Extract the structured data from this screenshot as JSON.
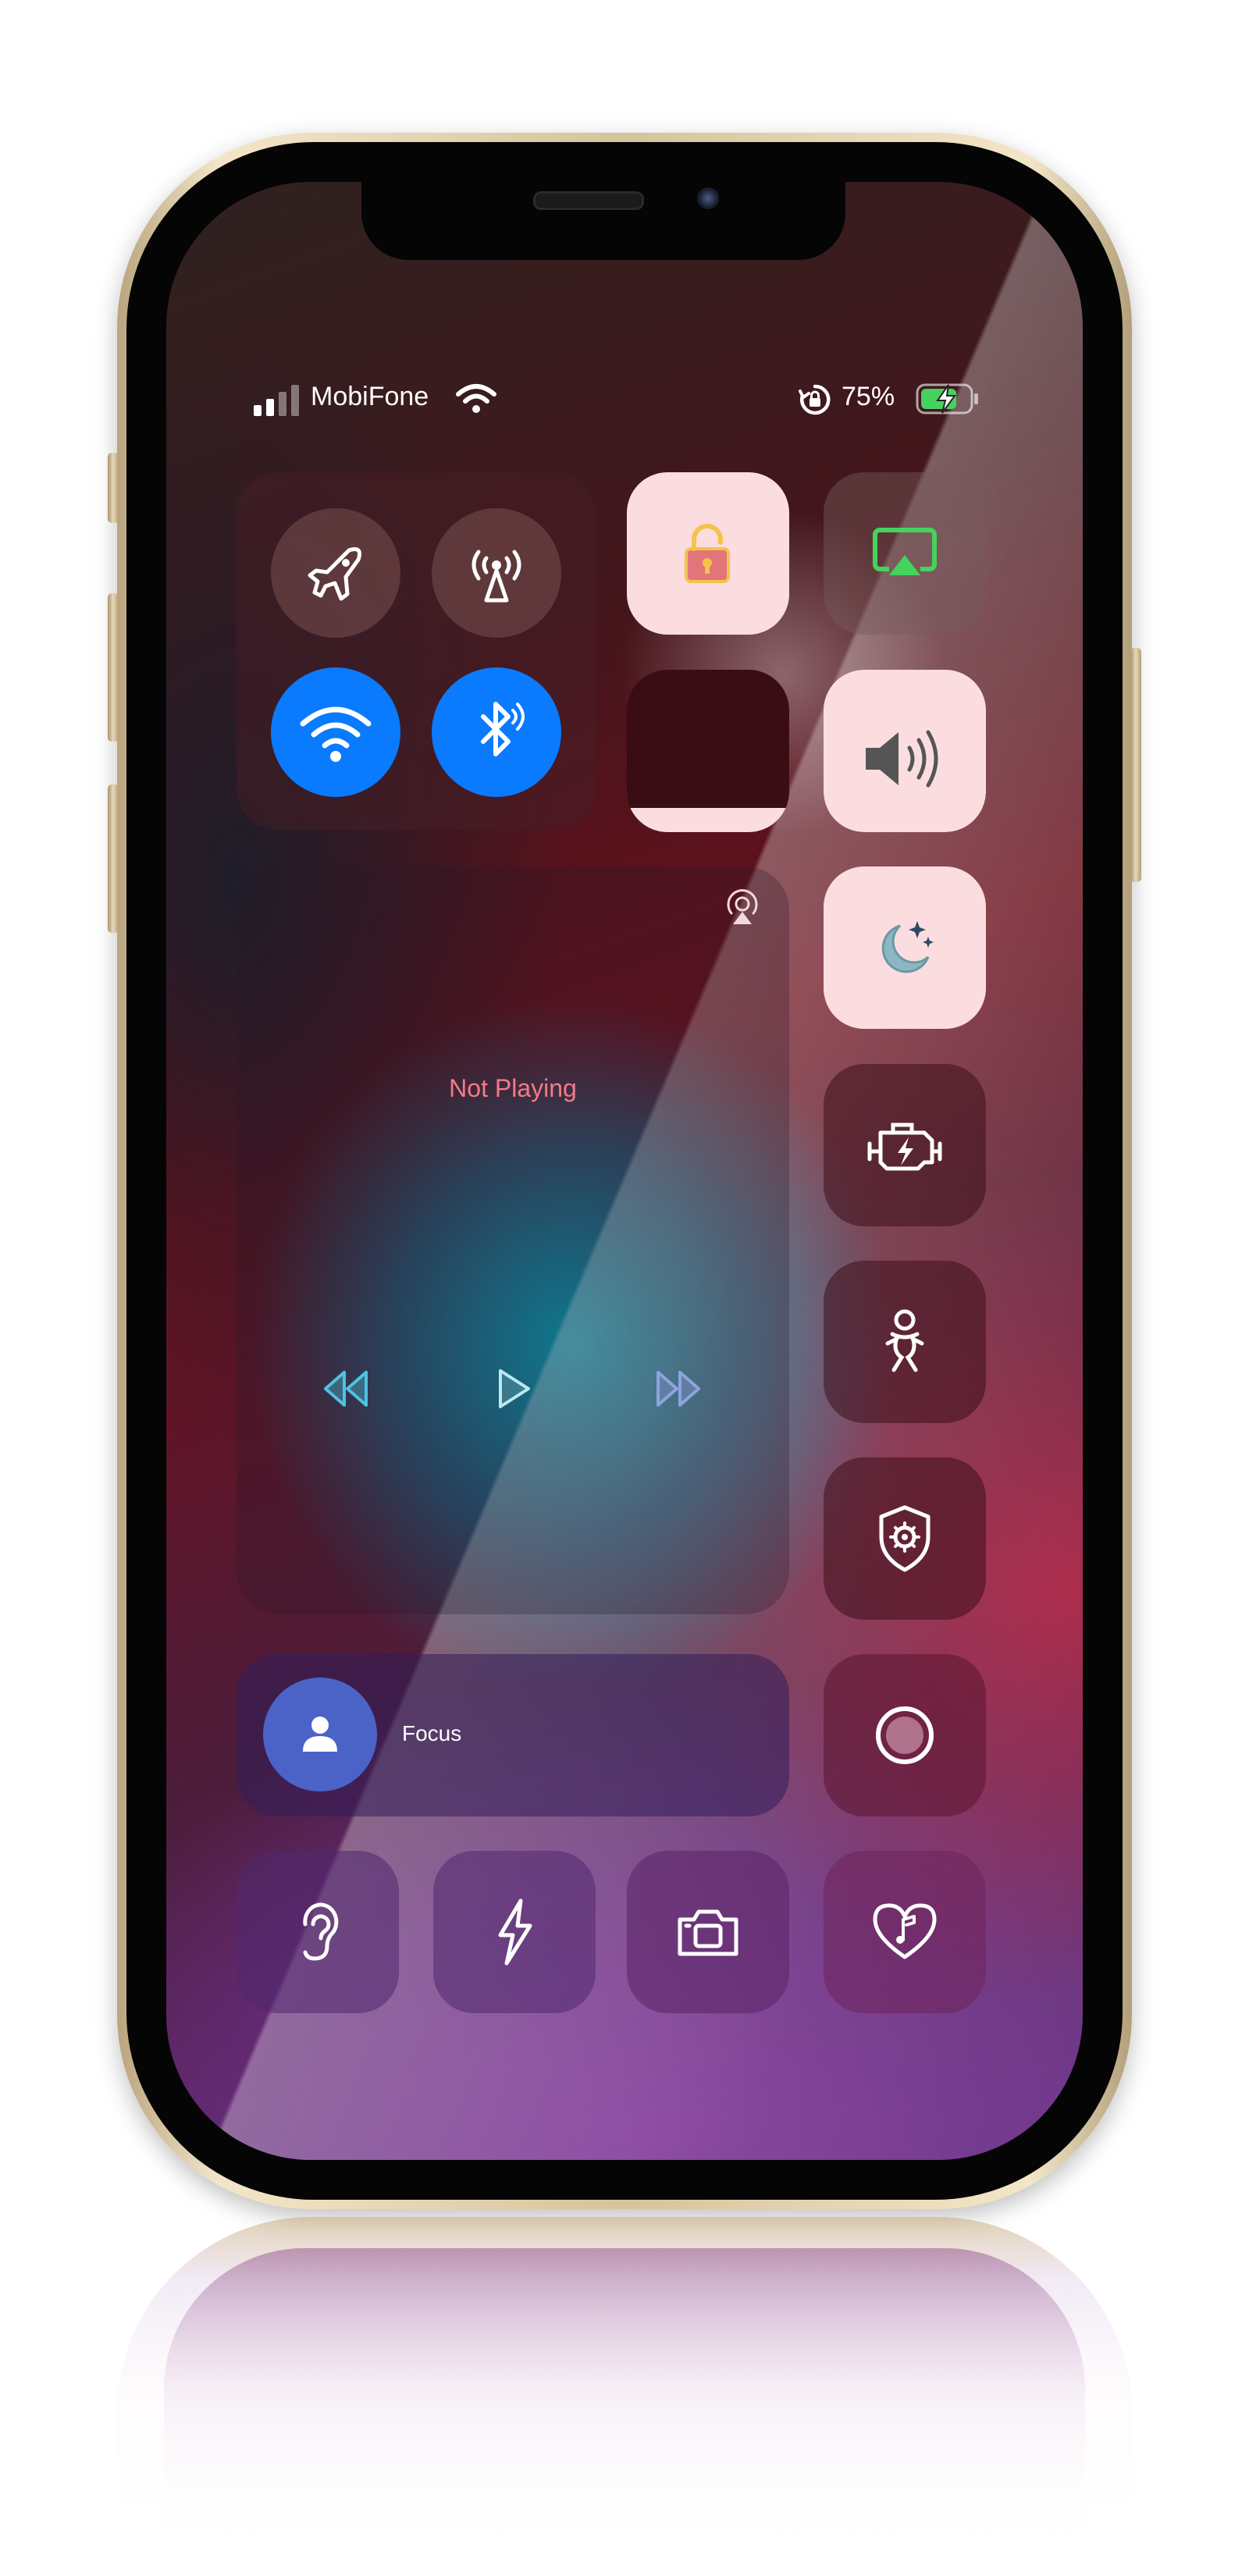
{
  "status_bar": {
    "carrier": "MobiFone",
    "battery_percent": "75%",
    "battery_level": 0.75,
    "charging": true,
    "signal_bars": 2
  },
  "connectivity": {
    "airplane_mode": {
      "icon": "airplane-icon",
      "active": false
    },
    "cellular": {
      "icon": "cellular-antenna-icon",
      "active": false
    },
    "wifi": {
      "icon": "wifi-icon",
      "active": true
    },
    "bluetooth": {
      "icon": "bluetooth-icon",
      "active": true
    }
  },
  "controls": {
    "orientation_lock": {
      "icon": "lock-rotation-icon",
      "active": true
    },
    "screen_mirroring": {
      "icon": "airplay-screen-icon"
    },
    "brightness": {
      "icon": "brightness",
      "level": 0.15
    },
    "volume": {
      "icon": "speaker-volume-icon",
      "level": 1.0
    },
    "dark_mode": {
      "icon": "moon-stars-icon",
      "active": true
    }
  },
  "media": {
    "now_playing": "Not Playing",
    "airplay_icon": "airplay-audio-icon",
    "controls": [
      "rewind-icon",
      "play-icon",
      "fast-forward-icon"
    ]
  },
  "focus": {
    "label": "Focus",
    "icon": "person-icon"
  },
  "side_column": [
    {
      "name": "engine-icon"
    },
    {
      "name": "baby-icon"
    },
    {
      "name": "shield-gear-icon"
    },
    {
      "name": "circle-ring-icon"
    }
  ],
  "bottom_row": [
    {
      "name": "ear-icon"
    },
    {
      "name": "flash-icon"
    },
    {
      "name": "camera-icon"
    },
    {
      "name": "heart-music-icon"
    }
  ],
  "colors": {
    "accent_blue": "#0a7aff",
    "tile_light": "#fbdde0",
    "now_playing_text": "#f47a86",
    "focus_circle": "#4b63c6",
    "mirroring_green": "#45d35c"
  }
}
